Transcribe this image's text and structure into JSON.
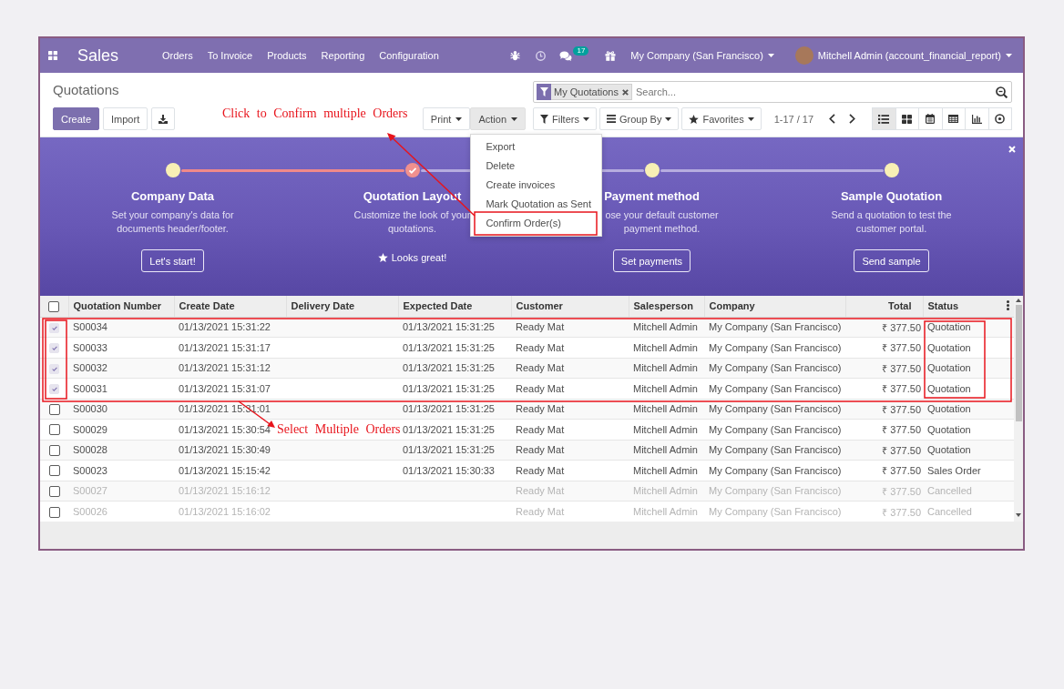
{
  "navbar": {
    "app_name": "Sales",
    "menu": [
      "Orders",
      "To Invoice",
      "Products",
      "Reporting",
      "Configuration"
    ],
    "message_count": "17",
    "company": "My Company (San Francisco)",
    "user": "Mitchell Admin (account_financial_report)"
  },
  "control_panel": {
    "breadcrumb": "Quotations",
    "buttons": [
      {
        "label": "Create",
        "kind": "primary"
      },
      {
        "label": "Import",
        "kind": "secondary"
      }
    ],
    "action_menus": [
      {
        "label": "Print",
        "open": false
      },
      {
        "label": "Action",
        "open": true
      }
    ],
    "action_dropdown": [
      "Export",
      "Delete",
      "Create invoices",
      "Mark Quotation as Sent",
      "Confirm Order(s)"
    ],
    "search": {
      "facets": [
        "My Quotations"
      ],
      "placeholder": "Search..."
    },
    "search_options": [
      {
        "label": "Filters",
        "kind": "filter"
      },
      {
        "label": "Group By",
        "kind": "group"
      },
      {
        "label": "Favorites",
        "kind": "favorite"
      }
    ],
    "pager": "1-17 / 17",
    "views": [
      {
        "kind": "list",
        "selected": true
      },
      {
        "kind": "kanban",
        "selected": false
      },
      {
        "kind": "calendar",
        "selected": false
      },
      {
        "kind": "pivot",
        "selected": false
      },
      {
        "kind": "graph",
        "selected": false
      },
      {
        "kind": "activity",
        "selected": false
      }
    ]
  },
  "onboarding": {
    "steps": [
      {
        "title": "Company Data",
        "description": "Set your company's data for documents header/footer.",
        "done": false,
        "button": "Let's start!"
      },
      {
        "title": "Quotation Layout",
        "description": "Customize the look of your quotations.",
        "done": true,
        "done_label": "Looks great!"
      },
      {
        "title": "Payment method",
        "description": "ose your default customer payment method.",
        "done": false,
        "button": "Set payments"
      },
      {
        "title": "Sample Quotation",
        "description": "Send a quotation to test the customer portal.",
        "done": false,
        "button": "Send sample"
      }
    ]
  },
  "table": {
    "select_all_checked": false,
    "columns": [
      {
        "label": "Quotation Number",
        "kind": "char"
      },
      {
        "label": "Create Date",
        "kind": "datetime"
      },
      {
        "label": "Delivery Date",
        "kind": "datetime"
      },
      {
        "label": "Expected Date",
        "kind": "datetime"
      },
      {
        "label": "Customer",
        "kind": "char"
      },
      {
        "label": "Salesperson",
        "kind": "char"
      },
      {
        "label": "Company",
        "kind": "char"
      },
      {
        "label": "Total",
        "kind": "monetary"
      },
      {
        "label": "Status",
        "kind": "selection"
      }
    ],
    "rows": [
      {
        "selected": true,
        "dimmed": false,
        "cells": [
          "S00034",
          "01/13/2021 15:31:22",
          null,
          "01/13/2021 15:31:25",
          "Ready Mat",
          "Mitchell Admin",
          "My Company (San Francisco)",
          "₹ 377.50",
          "Quotation"
        ]
      },
      {
        "selected": true,
        "dimmed": false,
        "cells": [
          "S00033",
          "01/13/2021 15:31:17",
          null,
          "01/13/2021 15:31:25",
          "Ready Mat",
          "Mitchell Admin",
          "My Company (San Francisco)",
          "₹ 377.50",
          "Quotation"
        ]
      },
      {
        "selected": true,
        "dimmed": false,
        "cells": [
          "S00032",
          "01/13/2021 15:31:12",
          null,
          "01/13/2021 15:31:25",
          "Ready Mat",
          "Mitchell Admin",
          "My Company (San Francisco)",
          "₹ 377.50",
          "Quotation"
        ]
      },
      {
        "selected": true,
        "dimmed": false,
        "cells": [
          "S00031",
          "01/13/2021 15:31:07",
          null,
          "01/13/2021 15:31:25",
          "Ready Mat",
          "Mitchell Admin",
          "My Company (San Francisco)",
          "₹ 377.50",
          "Quotation"
        ]
      },
      {
        "selected": false,
        "dimmed": false,
        "cells": [
          "S00030",
          "01/13/2021 15:31:01",
          null,
          "01/13/2021 15:31:25",
          "Ready Mat",
          "Mitchell Admin",
          "My Company (San Francisco)",
          "₹ 377.50",
          "Quotation"
        ]
      },
      {
        "selected": false,
        "dimmed": false,
        "cells": [
          "S00029",
          "01/13/2021 15:30:54",
          null,
          "01/13/2021 15:31:25",
          "Ready Mat",
          "Mitchell Admin",
          "My Company (San Francisco)",
          "₹ 377.50",
          "Quotation"
        ]
      },
      {
        "selected": false,
        "dimmed": false,
        "cells": [
          "S00028",
          "01/13/2021 15:30:49",
          null,
          "01/13/2021 15:31:25",
          "Ready Mat",
          "Mitchell Admin",
          "My Company (San Francisco)",
          "₹ 377.50",
          "Quotation"
        ]
      },
      {
        "selected": false,
        "dimmed": false,
        "cells": [
          "S00023",
          "01/13/2021 15:15:42",
          null,
          "01/13/2021 15:30:33",
          "Ready Mat",
          "Mitchell Admin",
          "My Company (San Francisco)",
          "₹ 377.50",
          "Sales Order"
        ]
      },
      {
        "selected": false,
        "dimmed": true,
        "cells": [
          "S00027",
          "01/13/2021 15:16:12",
          null,
          null,
          "Ready Mat",
          "Mitchell Admin",
          "My Company (San Francisco)",
          "₹ 377.50",
          "Cancelled"
        ]
      },
      {
        "selected": false,
        "dimmed": true,
        "cells": [
          "S00026",
          "01/13/2021 15:16:02",
          null,
          null,
          "Ready Mat",
          "Mitchell Admin",
          "My Company (San Francisco)",
          "₹ 377.50",
          "Cancelled"
        ]
      }
    ]
  },
  "annotations": [
    {
      "text": "Click to Confirm multiple Orders"
    },
    {
      "text": "Select Multiple Orders"
    }
  ]
}
